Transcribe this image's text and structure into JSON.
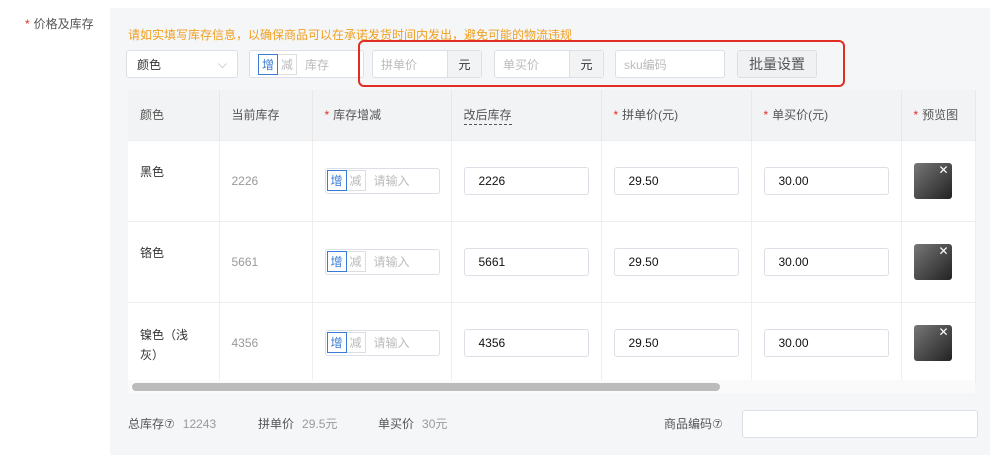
{
  "field_label": "价格及库存",
  "warning": "请如实填写库存信息，以确保商品可以在承诺发货时间内发出，避免可能的物流违规",
  "toolbar": {
    "select": "颜色",
    "inc": "增",
    "dec": "减",
    "stock_ph": "库存",
    "group_price_ph": "拼单价",
    "single_price_ph": "单买价",
    "unit": "元",
    "sku_ph": "sku编码",
    "batch": "批量设置"
  },
  "headers": [
    "颜色",
    "当前库存",
    "库存增减",
    "改后库存",
    "拼单价(元)",
    "单买价(元)",
    "预览图"
  ],
  "rows": [
    {
      "color": "黑色",
      "stock": "2226",
      "new_stock": "2226",
      "group": "29.50",
      "single": "30.00"
    },
    {
      "color": "铬色",
      "stock": "5661",
      "new_stock": "5661",
      "group": "29.50",
      "single": "30.00"
    },
    {
      "color": "镍色（浅灰）",
      "stock": "4356",
      "new_stock": "4356",
      "group": "29.50",
      "single": "30.00"
    }
  ],
  "row_input_ph": "请输入",
  "footer": {
    "total_label": "总库存⑦",
    "total": "12243",
    "group_label": "拼单价",
    "group": "29.5元",
    "single_label": "单买价",
    "single": "30元",
    "code_label": "商品编码⑦"
  }
}
